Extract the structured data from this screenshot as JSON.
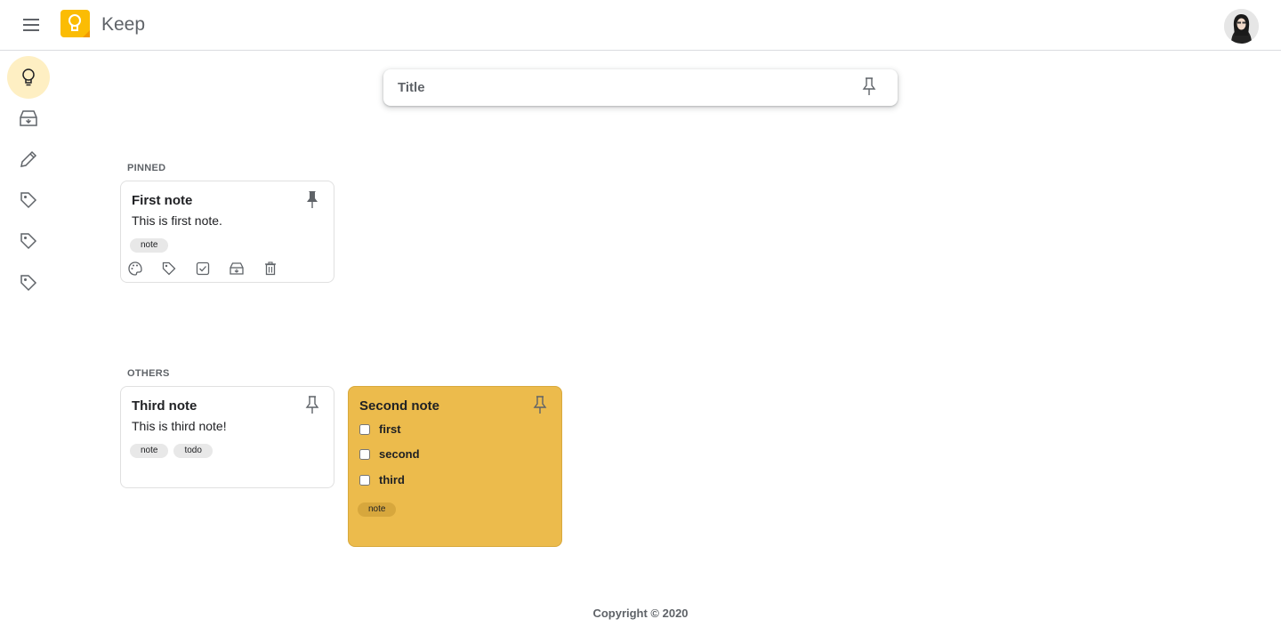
{
  "header": {
    "title": "Keep"
  },
  "sidebar": {
    "items": [
      {
        "name": "notes",
        "icon": "lightbulb-icon",
        "active": true
      },
      {
        "name": "archive",
        "icon": "archive-icon"
      },
      {
        "name": "edit-labels",
        "icon": "pencil-icon"
      },
      {
        "name": "label-1",
        "icon": "label-icon"
      },
      {
        "name": "label-2",
        "icon": "label-icon"
      },
      {
        "name": "label-3",
        "icon": "label-icon"
      }
    ]
  },
  "take_note": {
    "placeholder": "Title"
  },
  "sections": {
    "pinned": "PINNED",
    "others": "OTHERS"
  },
  "notes": {
    "first": {
      "title": "First note",
      "body": "This is first note.",
      "tags": [
        "note"
      ]
    },
    "third": {
      "title": "Third note",
      "body": "This is third note!",
      "tags": [
        "note",
        "todo"
      ]
    },
    "second": {
      "title": "Second note",
      "checklist": [
        "first",
        "second",
        "third"
      ],
      "tags": [
        "note"
      ],
      "color": "#ecbb4c"
    }
  },
  "footer": {
    "text": "Copyright © 2020"
  },
  "colors": {
    "accent": "#fbbc04",
    "active_bg": "#feefc3"
  }
}
